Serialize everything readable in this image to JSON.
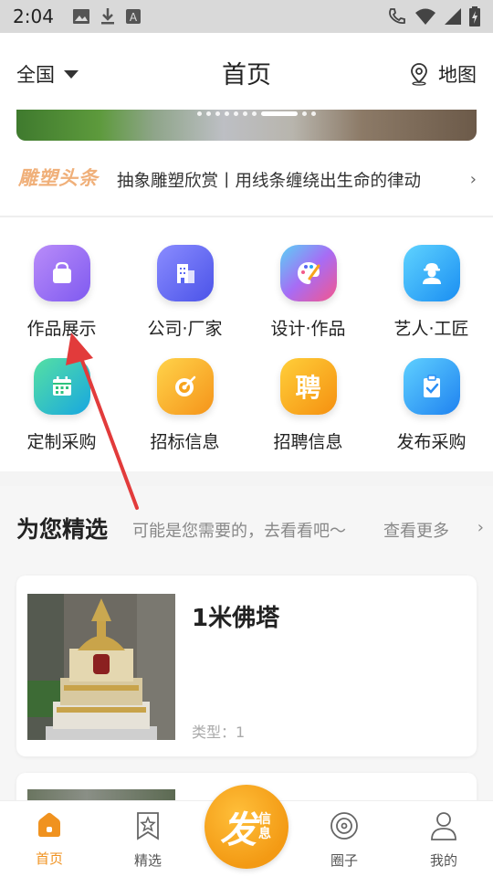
{
  "status_bar": {
    "time": "2:04"
  },
  "header": {
    "region": "全国",
    "title": "首页",
    "map_label": "地图"
  },
  "news": {
    "logo": "雕塑头条",
    "headline": "抽象雕塑欣赏丨用线条缠绕出生命的律动"
  },
  "grid": [
    {
      "label": "作品展示",
      "icon": "shopping-bag-icon",
      "color": "#8a63f0"
    },
    {
      "label": "公司·厂家",
      "icon": "building-icon",
      "color": "#5a67f2"
    },
    {
      "label": "设计·作品",
      "icon": "palette-icon",
      "color": "#f25a8c"
    },
    {
      "label": "艺人·工匠",
      "icon": "worker-icon",
      "color": "#23a7f5"
    },
    {
      "label": "定制采购",
      "icon": "calendar-icon",
      "color": "#2ec27e"
    },
    {
      "label": "招标信息",
      "icon": "target-icon",
      "color": "#f7a31c"
    },
    {
      "label": "招聘信息",
      "icon": "hire-icon",
      "color": "#f79a1c"
    },
    {
      "label": "发布采购",
      "icon": "clipboard-icon",
      "color": "#2a8ef5"
    }
  ],
  "picks": {
    "title": "为您精选",
    "subtitle": "可能是您需要的，去看看吧～",
    "more": "查看更多",
    "items": [
      {
        "title": "1米佛塔",
        "type": "类型：1"
      }
    ]
  },
  "hire_glyph": "聘",
  "bottom_nav": {
    "home": "首页",
    "featured": "精选",
    "post_big": "发",
    "post_small": "信息",
    "circle": "圈子",
    "mine": "我的"
  },
  "colors": {
    "accent": "#f0921f",
    "arrow": "#e23b3b"
  }
}
